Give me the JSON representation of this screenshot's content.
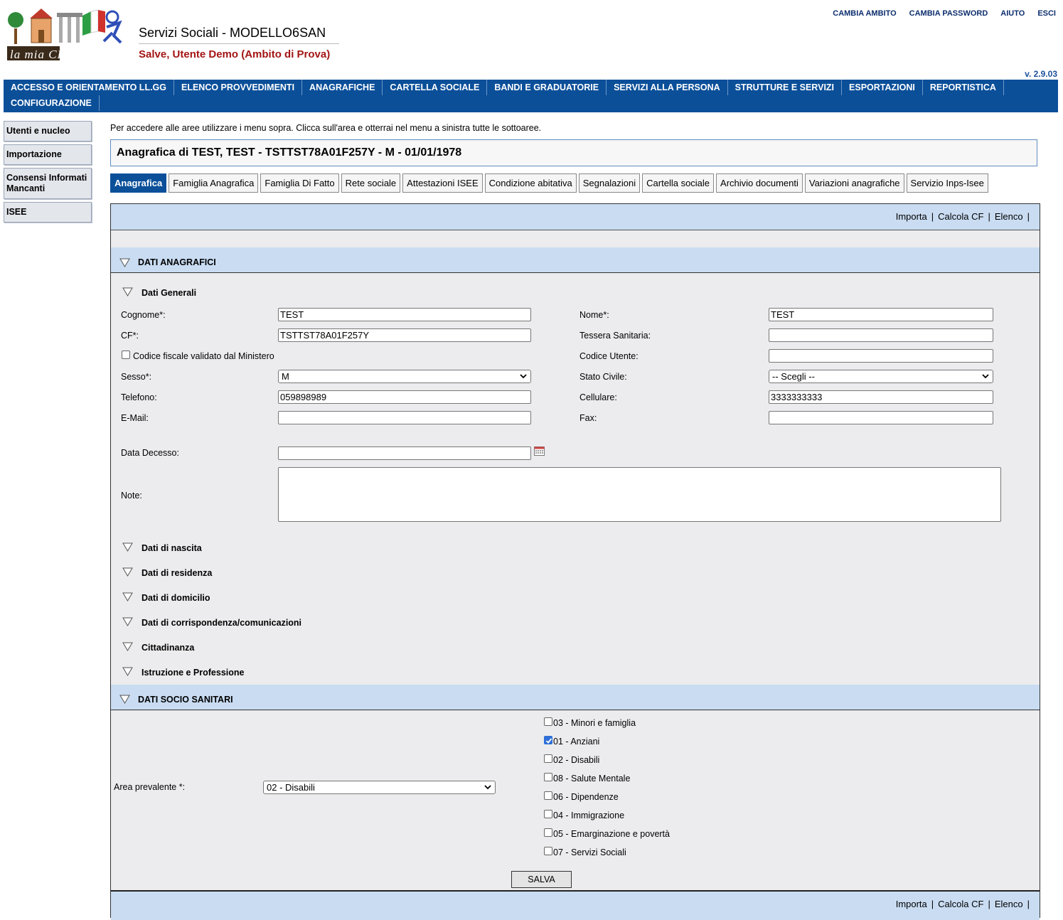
{
  "header": {
    "logo_text": "la mia CITTÀ",
    "app_title": "Servizi Sociali - MODELLO6SAN",
    "greeting": "Salve,  Utente Demo (Ambito di Prova)",
    "links": [
      "CAMBIA AMBITO",
      "CAMBIA PASSWORD",
      "AIUTO",
      "ESCI"
    ],
    "version": "v. 2.9.03"
  },
  "mainnav": [
    "ACCESSO E ORIENTAMENTO LL.GG",
    "ELENCO PROVVEDIMENTI",
    "ANAGRAFICHE",
    "CARTELLA SOCIALE",
    "BANDI E GRADUATORIE",
    "SERVIZI ALLA PERSONA",
    "STRUTTURE E SERVIZI",
    "ESPORTAZIONI",
    "REPORTISTICA",
    "CONFIGURAZIONE"
  ],
  "sidebar": [
    "Utenti e nucleo",
    "Importazione",
    "Consensi Informati Mancanti",
    "ISEE"
  ],
  "intro": "Per accedere alle aree utilizzare i menu sopra. Clicca sull'area e otterrai nel menu a sinistra tutte le sottoaree.",
  "page_title": "Anagrafica di TEST, TEST - TSTTST78A01F257Y - M - 01/01/1978",
  "tabs": [
    "Anagrafica",
    "Famiglia Anagrafica",
    "Famiglia Di Fatto",
    "Rete sociale",
    "Attestazioni ISEE",
    "Condizione abitativa",
    "Segnalazioni",
    "Cartella sociale",
    "Archivio documenti",
    "Variazioni anagrafiche",
    "Servizio Inps-Isee"
  ],
  "toolbar": {
    "importa": "Importa",
    "calcola": "Calcola CF",
    "elenco": "Elenco",
    "sep": "|"
  },
  "section_anagrafici": "DATI ANAGRAFICI",
  "dati_generali": "Dati Generali",
  "form": {
    "cognome_label": "Cognome*:",
    "cognome_value": "TEST",
    "nome_label": "Nome*:",
    "nome_value": "TEST",
    "cf_label": "CF*:",
    "cf_value": "TSTTST78A01F257Y",
    "tessera_label": "Tessera Sanitaria:",
    "tessera_value": "",
    "cf_validato_label": "Codice fiscale validato dal Ministero",
    "codice_utente_label": "Codice Utente:",
    "codice_utente_value": "",
    "sesso_label": "Sesso*:",
    "sesso_value": "M",
    "stato_civile_label": "Stato Civile:",
    "stato_civile_value": "-- Scegli --",
    "telefono_label": "Telefono:",
    "telefono_value": "059898989",
    "cellulare_label": "Cellulare:",
    "cellulare_value": "3333333333",
    "email_label": "E-Mail:",
    "email_value": "",
    "fax_label": "Fax:",
    "fax_value": "",
    "decesso_label": "Data Decesso:",
    "decesso_value": "",
    "note_label": "Note:"
  },
  "subsections": [
    "Dati di nascita",
    "Dati di residenza",
    "Dati di domicilio",
    "Dati di corrispondenza/comunicazioni",
    "Cittadinanza",
    "Istruzione e Professione"
  ],
  "section_socio": "DATI SOCIO SANITARI",
  "area_label": "Area prevalente *:",
  "area_value": "02 - Disabili",
  "areas": [
    {
      "label": "03 - Minori e famiglia",
      "checked": false
    },
    {
      "label": "01 - Anziani",
      "checked": true
    },
    {
      "label": "02 - Disabili",
      "checked": false
    },
    {
      "label": "08 - Salute Mentale",
      "checked": false
    },
    {
      "label": "06 - Dipendenze",
      "checked": false
    },
    {
      "label": "04 - Immigrazione",
      "checked": false
    },
    {
      "label": "05 - Emarginazione e povertà",
      "checked": false
    },
    {
      "label": "07 - Servizi Sociali",
      "checked": false
    }
  ],
  "save_label": "SALVA",
  "colors": {
    "nav_blue": "#0b4f99",
    "light_blue": "#c9dcf2",
    "greeting_red": "#a31515"
  }
}
